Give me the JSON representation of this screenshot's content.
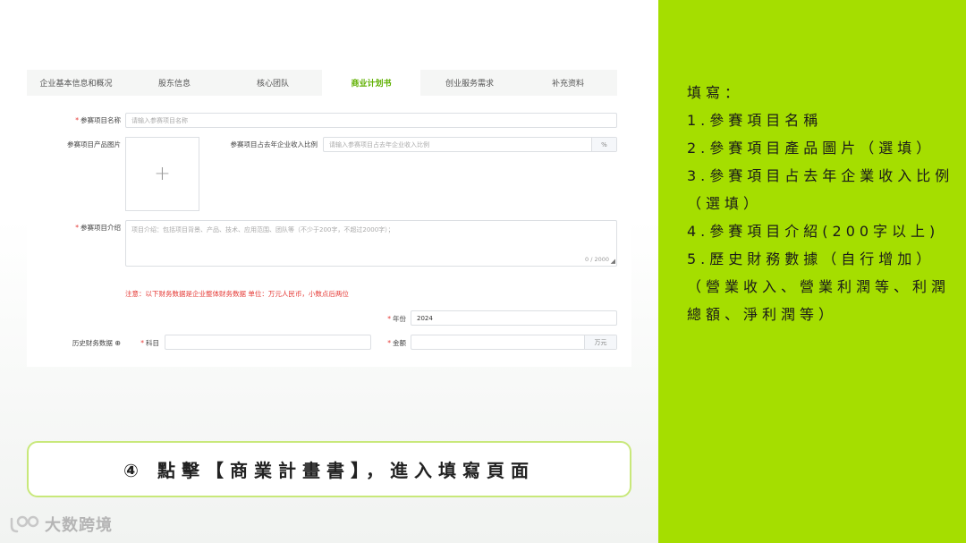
{
  "tabs": [
    {
      "label": "企业基本信息和概况"
    },
    {
      "label": "股东信息"
    },
    {
      "label": "核心团队"
    },
    {
      "label": "商业计划书"
    },
    {
      "label": "创业服务需求"
    },
    {
      "label": "补充资料"
    }
  ],
  "form": {
    "project_name": {
      "label": "参赛项目名称",
      "placeholder": "请输入参赛项目名称"
    },
    "product_image": {
      "label": "参赛项目产品图片"
    },
    "revenue_ratio": {
      "label": "参赛项目占去年企业收入比例",
      "placeholder": "请输入参赛项目占去年企业收入比例",
      "unit": "%"
    },
    "intro": {
      "label": "参赛项目介绍",
      "placeholder": "项目介绍：包括项目背景、产品、技术、应用范围、团队等（不少于200字，不超过2000字）；",
      "counter": "0 / 2000"
    },
    "notice": "注意：以下财务数据是企业整体财务数据 单位：万元人民币，小数点后两位",
    "year": {
      "label": "年份",
      "value": "2024"
    },
    "history_label": "历史财务数据",
    "subject": {
      "label": "科目"
    },
    "amount": {
      "label": "金额",
      "unit": "万元"
    }
  },
  "callout": "④ 點擊【商業計畫書】，進入填寫頁面",
  "logo": {
    "text": "大数跨境"
  },
  "instructions": [
    "填寫：",
    "1.參賽項目名稱",
    "2.參賽項目產品圖片（選填）",
    "3.參賽項目占去年企業收入比例（選填）",
    "4.參賽項目介紹(200字以上)",
    "5.歷史財務數據（自行增加）（營業收入、營業利潤等、利潤總額、淨利潤等）"
  ],
  "colors": {
    "panel": "#a5de00",
    "accent": "#5fb000",
    "required": "#e53935"
  }
}
